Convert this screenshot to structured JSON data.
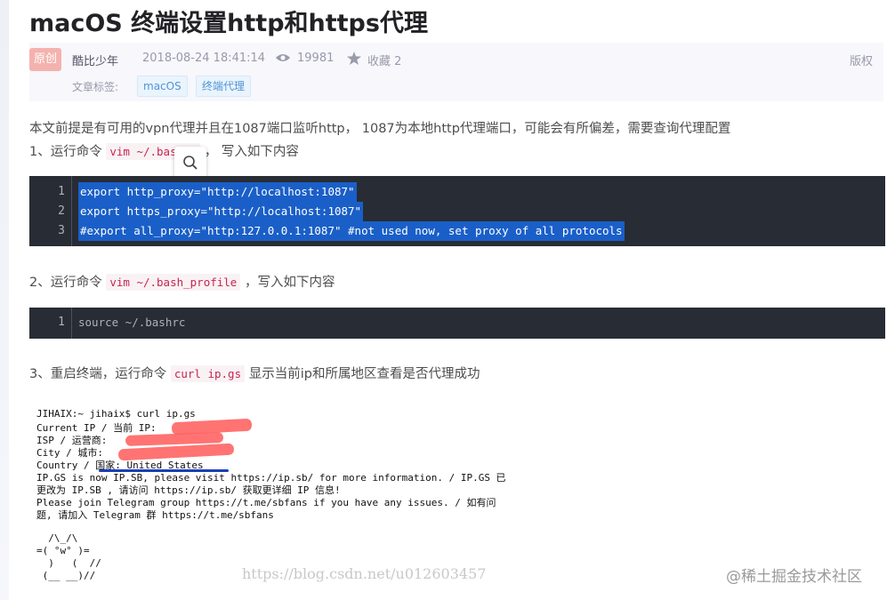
{
  "article": {
    "title": "macOS 终端设置http和https代理",
    "badge": "原创",
    "author": "酷比少年",
    "datetime": "2018-08-24 18:41:14",
    "views": "19981",
    "favorites": "收藏 2",
    "copyright": "版权",
    "tags_label": "文章标签:",
    "tags": [
      "macOS",
      "终端代理"
    ]
  },
  "content": {
    "intro": "本文前提是有可用的vpn代理并且在1087端口监听http， 1087为本地http代理端口，可能会有所偏差，需要查询代理配置",
    "step1_prefix": "1、运行命令",
    "step1_code": "vim ~/.bashrc",
    "step1_suffix": "， 写入如下内容",
    "code1": [
      {
        "num": "1",
        "text": "export http_proxy=\"http://localhost:1087\""
      },
      {
        "num": "2",
        "text": "export https_proxy=\"http://localhost:1087\""
      },
      {
        "num": "3",
        "text": "#export all_proxy=\"http:127.0.0.1:1087\"   #not used now, set proxy of all protocols"
      }
    ],
    "step2_prefix": "2、运行命令",
    "step2_code": "vim ~/.bash_profile",
    "step2_suffix": "，写入如下内容",
    "code2": [
      {
        "num": "1",
        "text": "source ~/.bashrc"
      }
    ],
    "step3_prefix": "3、重启终端，运行命令",
    "step3_code": "curl ip.gs",
    "step3_suffix": "显示当前ip和所属地区查看是否代理成功"
  },
  "terminal": {
    "lines": [
      "JIHAIX:~ jihaix$ curl ip.gs",
      "Current IP / 当前 IP:",
      "ISP / 运营商:",
      "City / 城市:",
      "Country / 国家: United States",
      "IP.GS is now IP.SB, please visit https://ip.sb/ for more information. / IP.GS 已",
      "更改为 IP.SB , 请访问 https://ip.sb/ 获取更详细 IP 信息!",
      "Please join Telegram group https://t.me/sbfans if you have any issues. / 如有问",
      "题, 请加入 Telegram 群 https://t.me/sbfans",
      "",
      "  /\\_/\\",
      "=( °w° )=",
      "  )   (  //",
      " (__ __)//"
    ]
  },
  "watermarks": {
    "csdn": "https://blog.csdn.net/u012603457",
    "juejin": "@稀土掘金技术社区"
  },
  "colors": {
    "selection": "#1a5fc8",
    "code_bg": "#282c34",
    "inline_code": "#c7254e",
    "redaction": "#ff5a5a"
  }
}
